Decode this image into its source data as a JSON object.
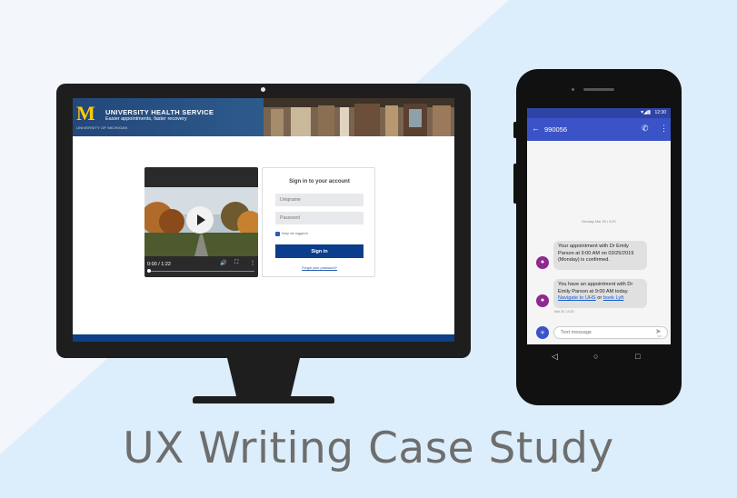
{
  "colors": {
    "background_light": "#f3f7fb",
    "background_blue": "#dceefb",
    "device_body": "#1e1e1e",
    "um_maize": "#ffcb05",
    "um_blue": "#0a3e8c",
    "phone_app_bar": "#3a53c6",
    "avatar": "#8e2a8e"
  },
  "desktop_site": {
    "logo_letter": "M",
    "logo_subtext": "UNIVERSITY OF MICHIGAN",
    "header_title": "UNIVERSITY HEALTH SERVICE",
    "header_tagline": "Easier appointments, faster recovery",
    "video": {
      "time": "0:00 / 1:22",
      "play_icon": "play-icon",
      "volume_icon": "volume-icon",
      "fullscreen_icon": "fullscreen-icon",
      "more_icon": "more-vertical-icon"
    },
    "login": {
      "title": "Sign in to your account",
      "username_placeholder": "Uniqname",
      "password_placeholder": "Password",
      "remember_label": "Keep me logged in",
      "signin_label": "Sign in",
      "forgot_label": "Forgot your password?"
    }
  },
  "phone": {
    "status_time": "12:30",
    "status_icons": "▾◢▮",
    "contact": "990056",
    "timestamp": "Monday Mar 25 • 9:20",
    "messages": [
      {
        "text": "Your appointment with Dr Emily Parson at 9:00 AM on 03/25/2019 (Monday) is confirmed."
      },
      {
        "text_before": "You have an appointment with Dr Emily Parson at 9:00 AM today.",
        "link1": "Navigate to UHS",
        "joiner": "or",
        "link2": "book Lyft",
        "time": "Mar 25, 10:20"
      }
    ],
    "compose_placeholder": "Text message",
    "sms_label": "SMS"
  },
  "title": "UX Writing Case Study"
}
